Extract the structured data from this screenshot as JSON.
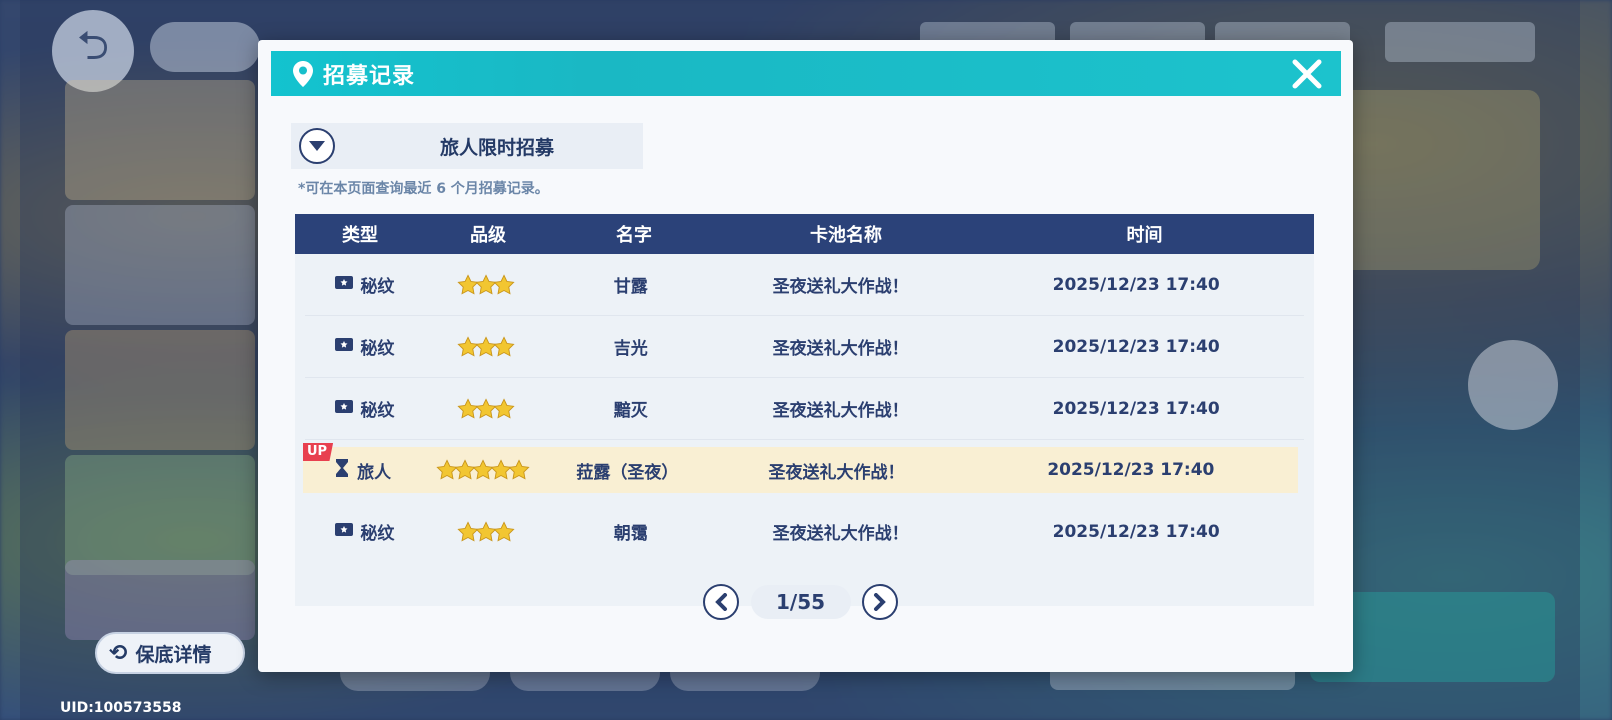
{
  "background": {
    "guarantee_button_label": "保底详情",
    "uid": "UID:100573558"
  },
  "modal": {
    "title": "招募记录",
    "pool_selector": "旅人限时招募",
    "note": "*可在本页面查询最近 6 个月招募记录。",
    "columns": [
      "类型",
      "品级",
      "名字",
      "卡池名称",
      "时间"
    ],
    "rows": [
      {
        "type": "秘纹",
        "type_icon": "ticket-icon",
        "stars": 3,
        "name": "甘露",
        "pool": "圣夜送礼大作战！",
        "time": "2025/12/23 17:40",
        "up": false
      },
      {
        "type": "秘纹",
        "type_icon": "ticket-icon",
        "stars": 3,
        "name": "吉光",
        "pool": "圣夜送礼大作战！",
        "time": "2025/12/23 17:40",
        "up": false
      },
      {
        "type": "秘纹",
        "type_icon": "ticket-icon",
        "stars": 3,
        "name": "黯灭",
        "pool": "圣夜送礼大作战！",
        "time": "2025/12/23 17:40",
        "up": false
      },
      {
        "type": "旅人",
        "type_icon": "traveler-icon",
        "stars": 5,
        "name": "菈露（圣夜）",
        "pool": "圣夜送礼大作战！",
        "time": "2025/12/23 17:40",
        "up": true,
        "up_label": "UP"
      },
      {
        "type": "秘纹",
        "type_icon": "ticket-icon",
        "stars": 3,
        "name": "朝霭",
        "pool": "圣夜送礼大作战！",
        "time": "2025/12/23 17:40",
        "up": false
      }
    ],
    "pagination": "1/55"
  },
  "colors": {
    "header": "#13c3cf",
    "table_header": "#2b4279",
    "text_dark": "#2b3f70",
    "highlight_row": "#f9efd3",
    "up_badge": "#e8404f",
    "star": "#f2c631"
  }
}
